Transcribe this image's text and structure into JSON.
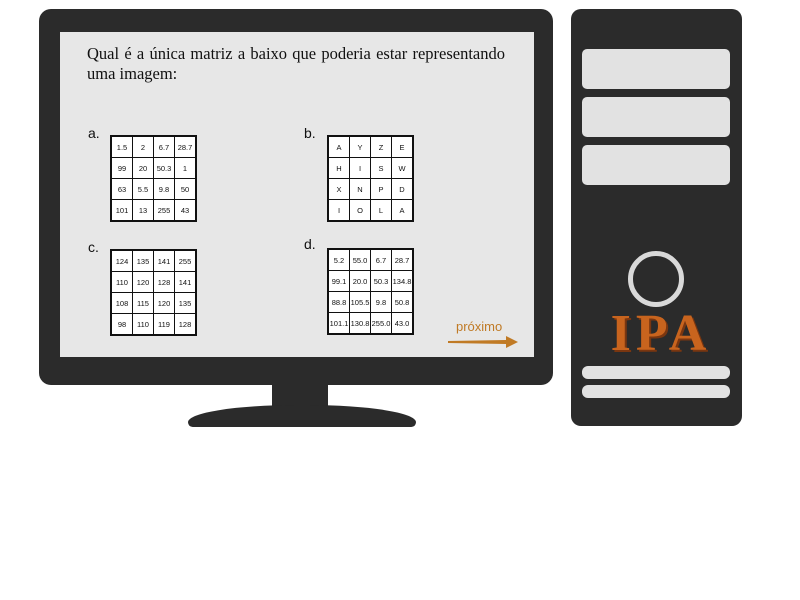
{
  "question": "Qual é a única matriz a baixo que poderia estar representando uma imagem:",
  "options": [
    {
      "label": "a.",
      "rows": [
        [
          "1.5",
          "2",
          "6.7",
          "28.7"
        ],
        [
          "99",
          "20",
          "50.3",
          "1"
        ],
        [
          "63",
          "5.5",
          "9.8",
          "50"
        ],
        [
          "101",
          "13",
          "255",
          "43"
        ]
      ]
    },
    {
      "label": "b.",
      "rows": [
        [
          "A",
          "Y",
          "Z",
          "E"
        ],
        [
          "H",
          "I",
          "S",
          "W"
        ],
        [
          "X",
          "N",
          "P",
          "D"
        ],
        [
          "I",
          "O",
          "L",
          "A"
        ]
      ]
    },
    {
      "label": "c.",
      "rows": [
        [
          "124",
          "135",
          "141",
          "255"
        ],
        [
          "110",
          "120",
          "128",
          "141"
        ],
        [
          "108",
          "115",
          "120",
          "135"
        ],
        [
          "98",
          "110",
          "119",
          "128"
        ]
      ]
    },
    {
      "label": "d.",
      "rows": [
        [
          "5.2",
          "55.0",
          "6.7",
          "28.7"
        ],
        [
          "99.1",
          "20.0",
          "50.3",
          "134.8"
        ],
        [
          "88.8",
          "105.5",
          "9.8",
          "50.8"
        ],
        [
          "101.1",
          "130.8",
          "255.0",
          "43.0"
        ]
      ]
    }
  ],
  "next_label": "próximo",
  "logo_text": "IPA",
  "colors": {
    "accent": "#c07a25",
    "logo": "#c8641e",
    "device": "#2b2b2b",
    "screen": "#e7e7e7"
  }
}
